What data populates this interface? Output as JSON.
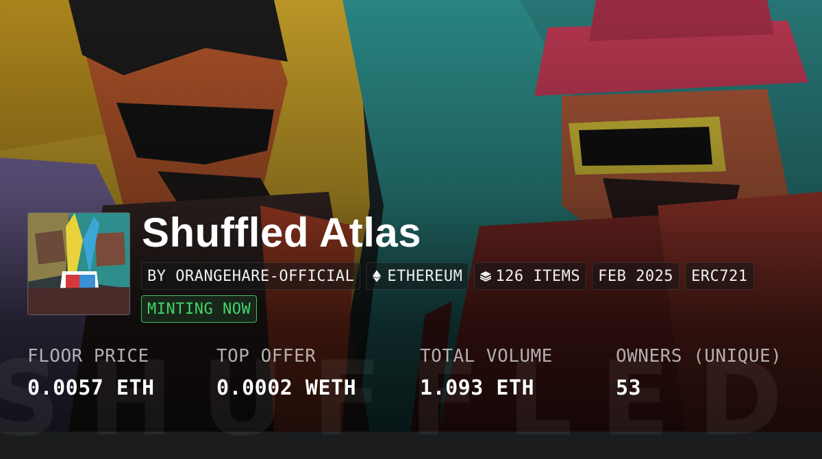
{
  "collection": {
    "name": "Shuffled Atlas",
    "watermark": "SHUFFLED ATLAS"
  },
  "meta_chips": [
    {
      "label": "BY ORANGEHARE-OFFICIAL",
      "icon": ""
    },
    {
      "label": "ETHEREUM",
      "icon": "ethereum-icon"
    },
    {
      "label": "126 ITEMS",
      "icon": "layers-icon"
    },
    {
      "label": "FEB 2025",
      "icon": ""
    },
    {
      "label": "ERC721",
      "icon": ""
    }
  ],
  "status": {
    "label": "MINTING NOW",
    "color": "#45d46b"
  },
  "stats": [
    {
      "label": "FLOOR PRICE",
      "value": "0.0057 ETH"
    },
    {
      "label": "TOP OFFER",
      "value": "0.0002 WETH"
    },
    {
      "label": "TOTAL VOLUME",
      "value": "1.093 ETH"
    },
    {
      "label": "OWNERS (UNIQUE)",
      "value": "53"
    }
  ]
}
